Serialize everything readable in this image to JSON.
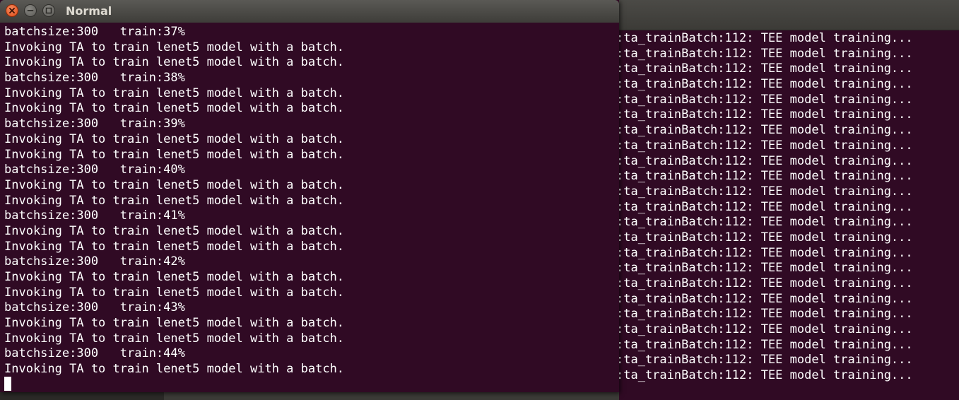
{
  "front_terminal": {
    "title": "Normal",
    "lines": [
      "batchsize:300   train:37%",
      "Invoking TA to train lenet5 model with a batch.",
      "Invoking TA to train lenet5 model with a batch.",
      "batchsize:300   train:38%",
      "Invoking TA to train lenet5 model with a batch.",
      "Invoking TA to train lenet5 model with a batch.",
      "batchsize:300   train:39%",
      "Invoking TA to train lenet5 model with a batch.",
      "Invoking TA to train lenet5 model with a batch.",
      "batchsize:300   train:40%",
      "Invoking TA to train lenet5 model with a batch.",
      "Invoking TA to train lenet5 model with a batch.",
      "batchsize:300   train:41%",
      "Invoking TA to train lenet5 model with a batch.",
      "Invoking TA to train lenet5 model with a batch.",
      "batchsize:300   train:42%",
      "Invoking TA to train lenet5 model with a batch.",
      "Invoking TA to train lenet5 model with a batch.",
      "batchsize:300   train:43%",
      "Invoking TA to train lenet5 model with a batch.",
      "Invoking TA to train lenet5 model with a batch.",
      "batchsize:300   train:44%",
      "Invoking TA to train lenet5 model with a batch."
    ],
    "controls": {
      "close_icon": "close-icon",
      "minimize_icon": "minimize-icon",
      "maximize_icon": "maximize-icon"
    }
  },
  "back_terminal": {
    "lines": [
      ":ta_trainBatch:112: TEE model training...",
      ":ta_trainBatch:112: TEE model training...",
      ":ta_trainBatch:112: TEE model training...",
      ":ta_trainBatch:112: TEE model training...",
      ":ta_trainBatch:112: TEE model training...",
      ":ta_trainBatch:112: TEE model training...",
      ":ta_trainBatch:112: TEE model training...",
      ":ta_trainBatch:112: TEE model training...",
      ":ta_trainBatch:112: TEE model training...",
      ":ta_trainBatch:112: TEE model training...",
      ":ta_trainBatch:112: TEE model training...",
      ":ta_trainBatch:112: TEE model training...",
      ":ta_trainBatch:112: TEE model training...",
      ":ta_trainBatch:112: TEE model training...",
      ":ta_trainBatch:112: TEE model training...",
      ":ta_trainBatch:112: TEE model training...",
      ":ta_trainBatch:112: TEE model training...",
      ":ta_trainBatch:112: TEE model training...",
      ":ta_trainBatch:112: TEE model training...",
      ":ta_trainBatch:112: TEE model training...",
      ":ta_trainBatch:112: TEE model training...",
      ":ta_trainBatch:112: TEE model training...",
      ":ta_trainBatch:112: TEE model training..."
    ]
  },
  "colors": {
    "terminal_bg": "#300a24",
    "terminal_text": "#ffffff",
    "close_button": "#df4a16",
    "accent": "#e95420"
  }
}
